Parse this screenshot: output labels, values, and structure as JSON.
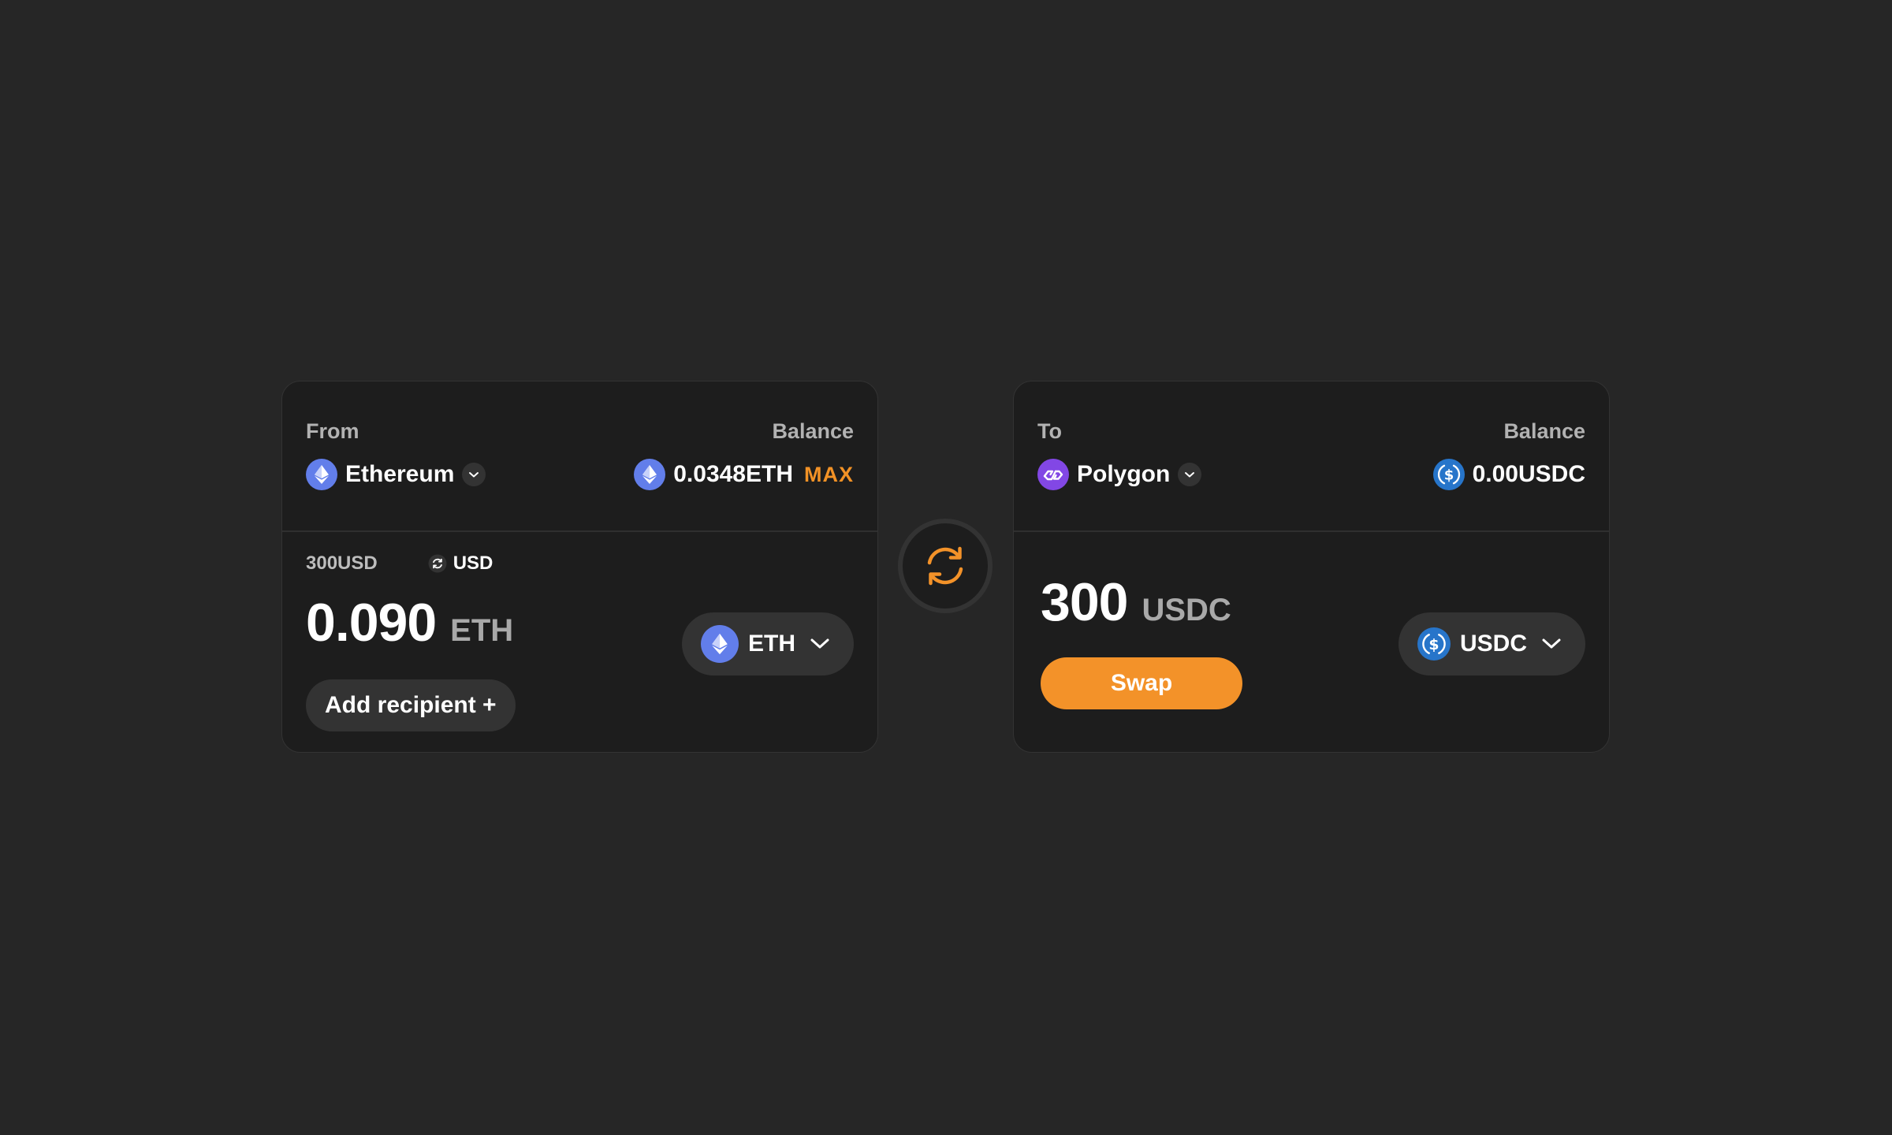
{
  "from": {
    "label": "From",
    "balance_label": "Balance",
    "network": "Ethereum",
    "network_icon": "ethereum-icon",
    "balance_value": "0.0348ETH",
    "max_label": "MAX",
    "usd_amount": "300USD",
    "currency_toggle": "USD",
    "amount": "0.090",
    "amount_unit": "ETH",
    "add_recipient": "Add recipient +",
    "token": "ETH"
  },
  "to": {
    "label": "To",
    "balance_label": "Balance",
    "network": "Polygon",
    "network_icon": "polygon-icon",
    "balance_value": "0.00USDC",
    "amount": "300",
    "amount_unit": "USDC",
    "swap_label": "Swap",
    "token": "USDC"
  },
  "colors": {
    "accent": "#f39229",
    "ethereum": "#627eea",
    "polygon": "#8247e5",
    "usdc": "#2775ca",
    "background": "#262626",
    "card": "#1d1d1d"
  }
}
